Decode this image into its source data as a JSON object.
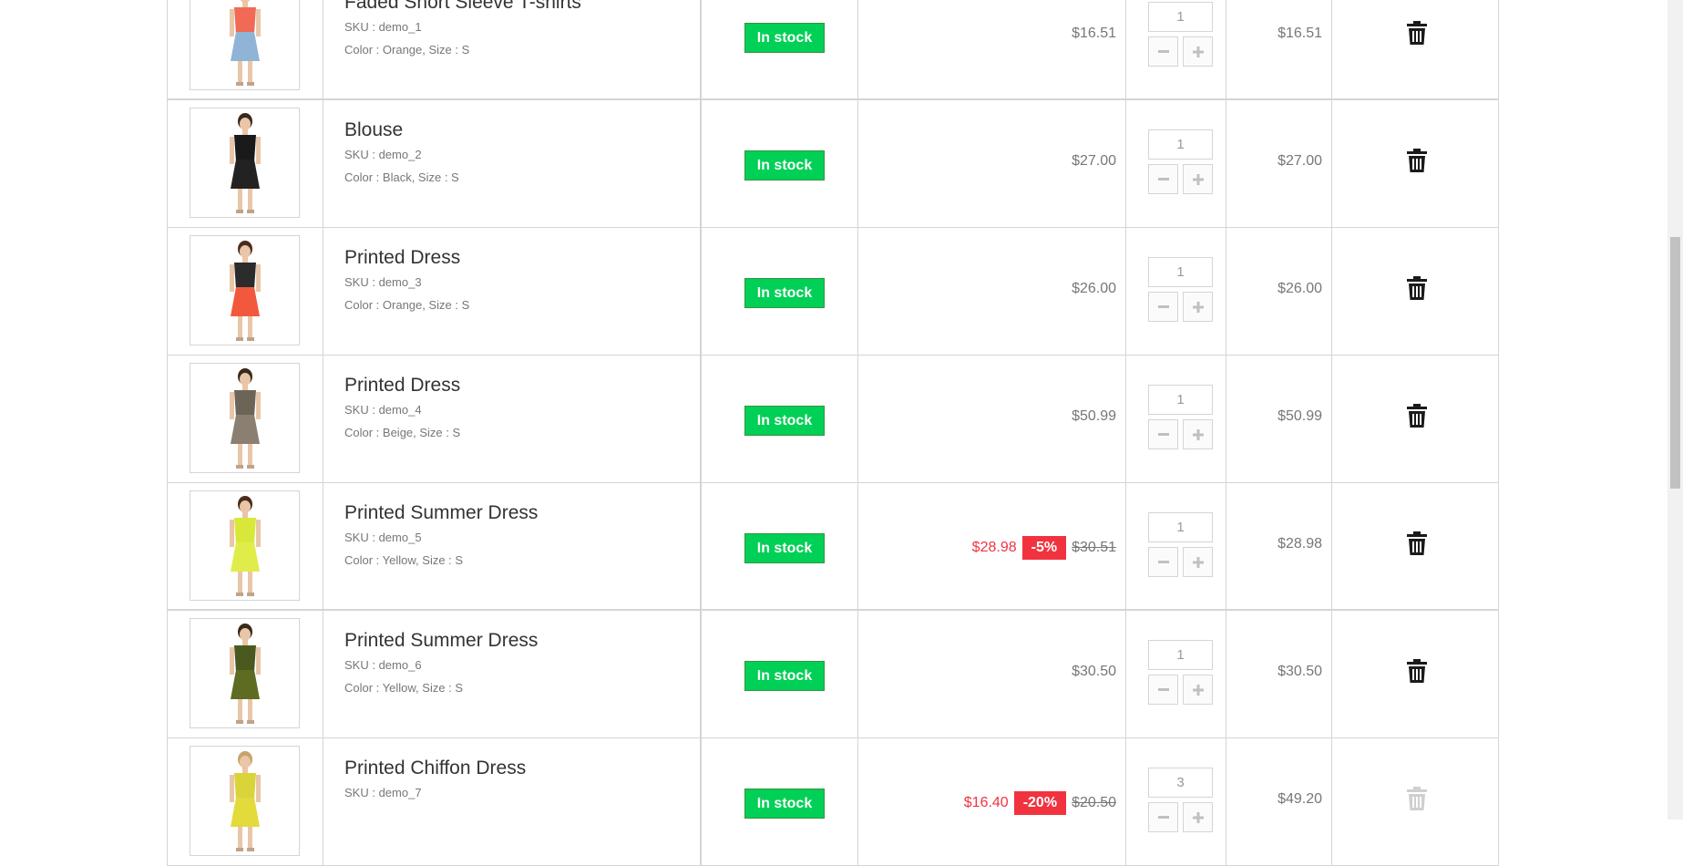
{
  "cart_rows": [
    {
      "name": "Faded Short Sleeve T-shirts",
      "sku": "SKU : demo_1",
      "attributes": "Color : Orange, Size : S",
      "availability": "In stock",
      "price": "$16.51",
      "quantity": "1",
      "total": "$16.51",
      "image": {
        "top": "#f06a55",
        "bottom": "#8fb4d6",
        "skin": "#e9c6a8",
        "hair": "#6b4a2c"
      }
    },
    {
      "name": "Blouse",
      "sku": "SKU : demo_2",
      "attributes": "Color : Black, Size : S",
      "availability": "In stock",
      "price": "$27.00",
      "quantity": "1",
      "total": "$27.00",
      "image": {
        "top": "#1a1a1a",
        "bottom": "#222222",
        "skin": "#e9c6a8",
        "hair": "#3a2a1c"
      }
    },
    {
      "name": "Printed Dress",
      "sku": "SKU : demo_3",
      "attributes": "Color : Orange, Size : S",
      "availability": "In stock",
      "price": "$26.00",
      "quantity": "1",
      "total": "$26.00",
      "image": {
        "top": "#2c2c2c",
        "bottom": "#f2583e",
        "skin": "#e9c6a8",
        "hair": "#4a2c1a"
      }
    },
    {
      "name": "Printed Dress",
      "sku": "SKU : demo_4",
      "attributes": "Color : Beige, Size : S",
      "availability": "In stock",
      "price": "$50.99",
      "quantity": "1",
      "total": "$50.99",
      "image": {
        "top": "#6d6458",
        "bottom": "#8a7f70",
        "skin": "#e9c6a8",
        "hair": "#3a2a1c"
      }
    },
    {
      "name": "Printed Summer Dress",
      "sku": "SKU : demo_5",
      "attributes": "Color : Yellow, Size : S",
      "availability": "In stock",
      "special_price": "$28.98",
      "reduction": "-5%",
      "old_price": "$30.51",
      "quantity": "1",
      "total": "$28.98",
      "image": {
        "top": "#d8e83a",
        "bottom": "#e0ec4a",
        "skin": "#e9c6a8",
        "hair": "#4a2c1a"
      }
    },
    {
      "name": "Printed Summer Dress",
      "sku": "SKU : demo_6",
      "attributes": "Color : Yellow, Size : S",
      "availability": "In stock",
      "price": "$30.50",
      "quantity": "1",
      "total": "$30.50",
      "image": {
        "top": "#4a5a1e",
        "bottom": "#5d6c22",
        "skin": "#e9c6a8",
        "hair": "#3a2a1c"
      }
    },
    {
      "name": "Printed Chiffon Dress",
      "sku": "SKU : demo_7",
      "attributes": "",
      "availability": "In stock",
      "special_price": "$16.40",
      "reduction": "-20%",
      "old_price": "$20.50",
      "quantity": "3",
      "total": "$49.20",
      "image": {
        "top": "#d9d43a",
        "bottom": "#e3da3c",
        "skin": "#e9c6a8",
        "hair": "#c9a36a"
      }
    }
  ],
  "icons": {
    "delete": "trash-icon",
    "minus": "minus-icon",
    "plus": "plus-icon"
  },
  "colors": {
    "in_stock_bg": "#00d055",
    "reduction_bg": "#f13340",
    "special_price": "#f13340",
    "border": "#d6d4d4"
  }
}
